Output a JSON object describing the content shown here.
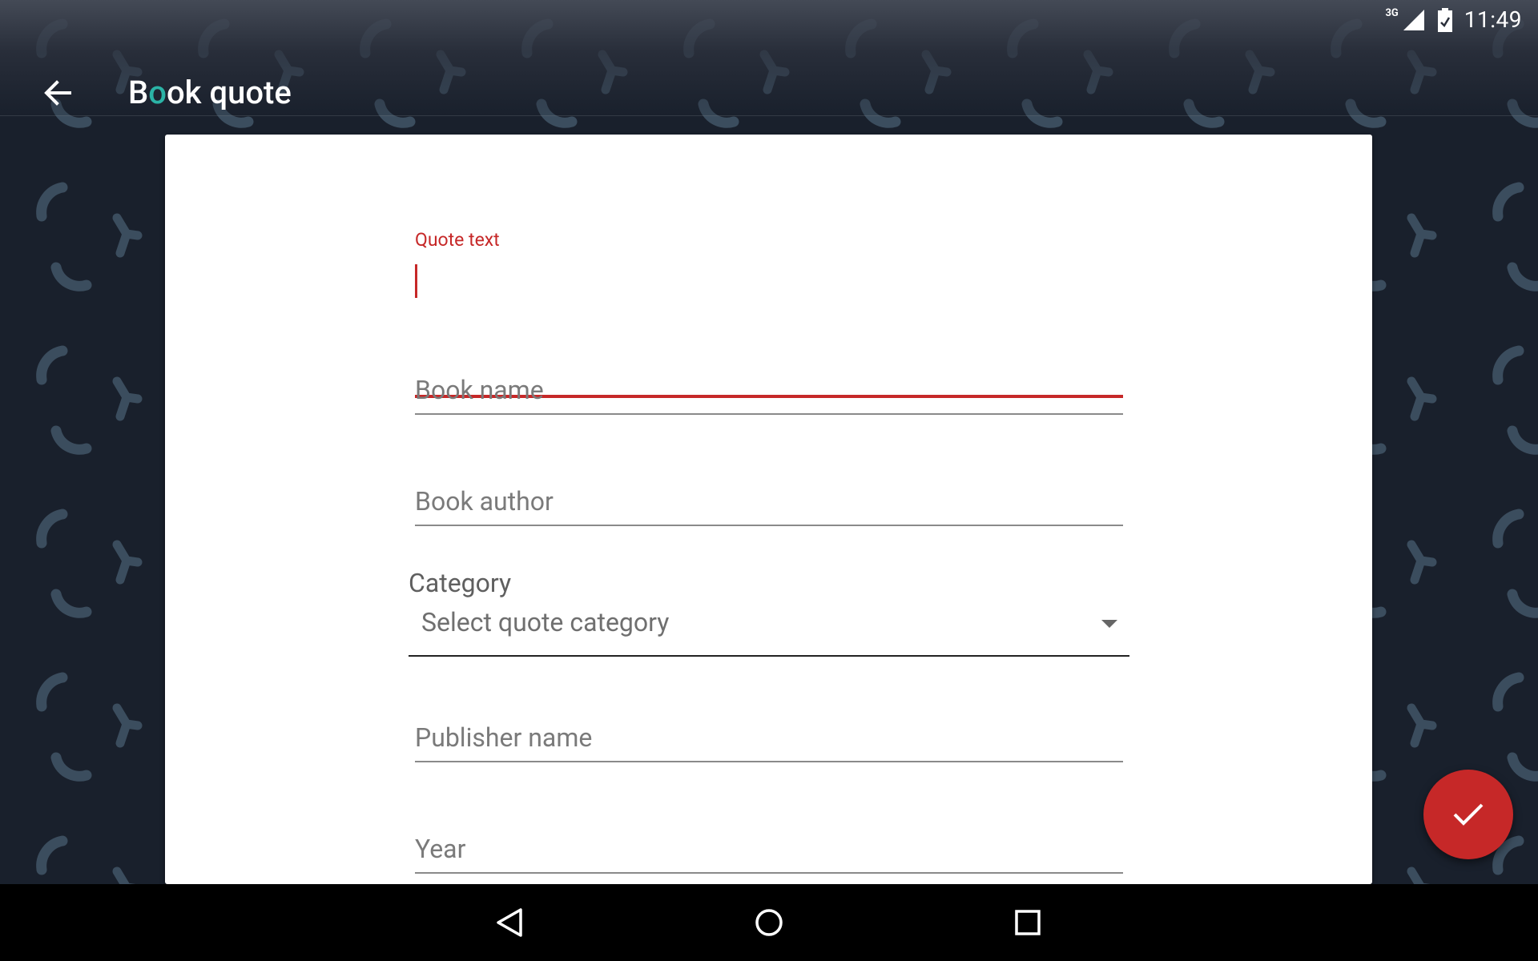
{
  "status_bar": {
    "network": "3G",
    "time": "11:49"
  },
  "app_bar": {
    "title_prefix": "B",
    "title_accent": "o",
    "title_suffix": "ok quote",
    "back_icon": "arrow-back-icon"
  },
  "form": {
    "quote_text": {
      "label": "Quote text",
      "value": ""
    },
    "book_name": {
      "placeholder": "Book name",
      "value": ""
    },
    "book_author": {
      "placeholder": "Book author",
      "value": ""
    },
    "category": {
      "label": "Category",
      "selected": "Select quote category"
    },
    "publisher_name": {
      "placeholder": "Publisher name",
      "value": ""
    },
    "year": {
      "placeholder": "Year",
      "value": ""
    }
  },
  "fab": {
    "icon": "check-icon"
  },
  "nav_bar": {
    "back_icon": "nav-back-icon",
    "home_icon": "nav-home-icon",
    "recents_icon": "nav-recents-icon"
  },
  "colors": {
    "accent": "#c62828",
    "title_accent": "#2bb3a6",
    "background": "#19202c",
    "pattern": "#3b4d5e"
  }
}
